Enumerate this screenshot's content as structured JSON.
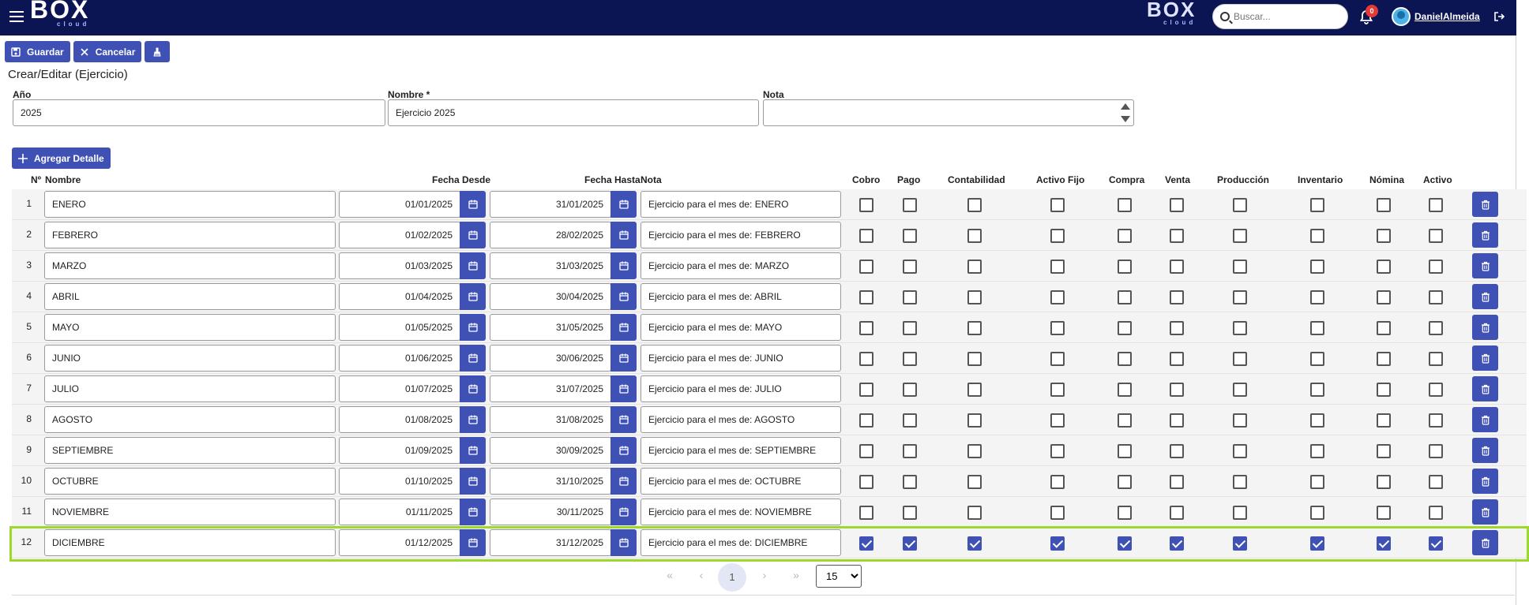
{
  "header": {
    "logo_text": "BOX",
    "logo_sub": "cloud",
    "search_placeholder": "Buscar...",
    "notification_count": "0",
    "username": "DanielAlmeida"
  },
  "toolbar": {
    "save_label": "Guardar",
    "cancel_label": "Cancelar"
  },
  "page": {
    "title": "Crear/Editar (Ejercicio)"
  },
  "form": {
    "year_label": "Año",
    "year_value": "2025",
    "name_label": "Nombre *",
    "name_value": "Ejercicio 2025",
    "note_label": "Nota",
    "note_value": ""
  },
  "add_detail_label": "Agregar Detalle",
  "table": {
    "columns": {
      "num": "Nº",
      "nombre": "Nombre",
      "desde": "Fecha Desde",
      "hasta": "Fecha Hasta",
      "nota": "Nota",
      "cobro": "Cobro",
      "pago": "Pago",
      "contabilidad": "Contabilidad",
      "activo_fijo": "Activo Fijo",
      "compra": "Compra",
      "venta": "Venta",
      "produccion": "Producción",
      "inventario": "Inventario",
      "nomina": "Nómina",
      "activo": "Activo"
    },
    "rows": [
      {
        "n": "1",
        "nombre": "ENERO",
        "desde": "01/01/2025",
        "hasta": "31/01/2025",
        "nota": "Ejercicio para el mes de: ENERO",
        "checked": false
      },
      {
        "n": "2",
        "nombre": "FEBRERO",
        "desde": "01/02/2025",
        "hasta": "28/02/2025",
        "nota": "Ejercicio para el mes de: FEBRERO",
        "checked": false
      },
      {
        "n": "3",
        "nombre": "MARZO",
        "desde": "01/03/2025",
        "hasta": "31/03/2025",
        "nota": "Ejercicio para el mes de: MARZO",
        "checked": false
      },
      {
        "n": "4",
        "nombre": "ABRIL",
        "desde": "01/04/2025",
        "hasta": "30/04/2025",
        "nota": "Ejercicio para el mes de: ABRIL",
        "checked": false
      },
      {
        "n": "5",
        "nombre": "MAYO",
        "desde": "01/05/2025",
        "hasta": "31/05/2025",
        "nota": "Ejercicio para el mes de: MAYO",
        "checked": false
      },
      {
        "n": "6",
        "nombre": "JUNIO",
        "desde": "01/06/2025",
        "hasta": "30/06/2025",
        "nota": "Ejercicio para el mes de: JUNIO",
        "checked": false
      },
      {
        "n": "7",
        "nombre": "JULIO",
        "desde": "01/07/2025",
        "hasta": "31/07/2025",
        "nota": "Ejercicio para el mes de: JULIO",
        "checked": false
      },
      {
        "n": "8",
        "nombre": "AGOSTO",
        "desde": "01/08/2025",
        "hasta": "31/08/2025",
        "nota": "Ejercicio para el mes de: AGOSTO",
        "checked": false
      },
      {
        "n": "9",
        "nombre": "SEPTIEMBRE",
        "desde": "01/09/2025",
        "hasta": "30/09/2025",
        "nota": "Ejercicio para el mes de: SEPTIEMBRE",
        "checked": false
      },
      {
        "n": "10",
        "nombre": "OCTUBRE",
        "desde": "01/10/2025",
        "hasta": "31/10/2025",
        "nota": "Ejercicio para el mes de: OCTUBRE",
        "checked": false
      },
      {
        "n": "11",
        "nombre": "NOVIEMBRE",
        "desde": "01/11/2025",
        "hasta": "30/11/2025",
        "nota": "Ejercicio para el mes de: NOVIEMBRE",
        "checked": false
      },
      {
        "n": "12",
        "nombre": "DICIEMBRE",
        "desde": "01/12/2025",
        "hasta": "31/12/2025",
        "nota": "Ejercicio para el mes de: DICIEMBRE",
        "checked": true
      }
    ]
  },
  "pager": {
    "current_page": "1",
    "page_size": "15",
    "page_size_options": [
      "15"
    ]
  },
  "colors": {
    "header_bg": "#0b1554",
    "accent": "#3f51b5",
    "selection_outline": "#9cd92b",
    "badge": "#e53935"
  },
  "icons": [
    "menu-icon",
    "search-icon",
    "bell-icon",
    "user-avatar",
    "logout-icon",
    "save-icon",
    "close-icon",
    "broom-icon",
    "plus-icon",
    "calendar-icon",
    "trash-icon"
  ]
}
